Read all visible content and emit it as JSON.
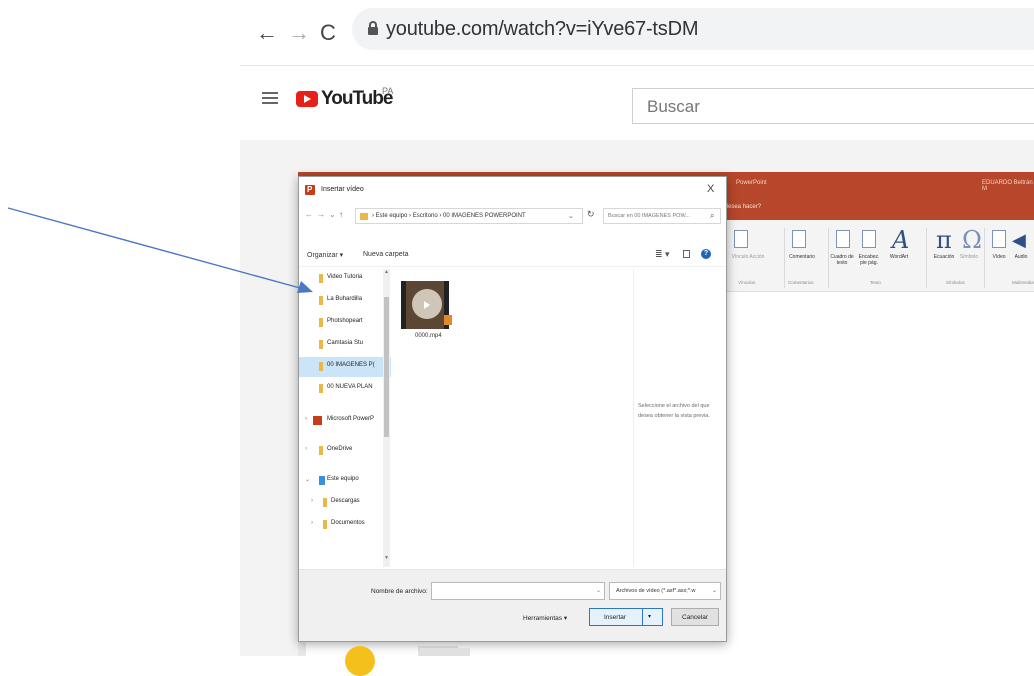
{
  "browser": {
    "back": "←",
    "forward": "→",
    "reload": "C",
    "url": "youtube.com/watch?v=iYve67-tsDM"
  },
  "youtube": {
    "logo_word": "YouTube",
    "country": "PA",
    "search_placeholder": "Buscar"
  },
  "powerpoint": {
    "title": "PowerPoint",
    "user": "EDUARDO Beltrán M",
    "tell_me": "¿Qué desea hacer?",
    "ribbon": [
      {
        "label": "Comentario",
        "group": "Comentarios"
      },
      {
        "label": "Cuadro de texto",
        "group": "Texto"
      },
      {
        "label": "Encabez. pie pág.",
        "group": ""
      },
      {
        "label": "WordArt",
        "group": ""
      },
      {
        "label": "Ecuación",
        "group": "Símbolos"
      },
      {
        "label": "Símbolo",
        "group": ""
      },
      {
        "label": "Vídeo",
        "group": "Multimedia"
      },
      {
        "label": "Audio",
        "group": ""
      }
    ],
    "group_vinculos": "Vínculos",
    "dim_label": "Vínculo Acción"
  },
  "dialog": {
    "title": "Insertar vídeo",
    "close": "X",
    "address": "› Este equipo › Escritorio › 00 IMAGENES POWERPOINT",
    "search_placeholder": "Buscar en 00 IMAGENES POW...",
    "organize": "Organizar ▾",
    "new_folder": "Nueva carpeta",
    "help": "?",
    "nav_items": [
      {
        "label": "Video Tutoria"
      },
      {
        "label": "La Buhardilla"
      },
      {
        "label": "Photshopeart"
      },
      {
        "label": "Camtasia Stu"
      },
      {
        "label": "00 IMAGENES P("
      },
      {
        "label": "00 NUEVA PLAN"
      },
      {
        "label": "Microsoft PowerP"
      },
      {
        "label": "OneDrive"
      },
      {
        "label": "Este equipo"
      },
      {
        "label": "Descargas"
      },
      {
        "label": "Documentos"
      }
    ],
    "file": {
      "name": "0000.mp4"
    },
    "preview_text": "Seleccione el archivo del que desea obtener la vista previa.",
    "filename_label": "Nombre de archivo:",
    "filename_value": "",
    "filetype": "Archivos de vídeo (*.asf*.asx;*.w",
    "tools": "Herramientas ▾",
    "insert": "Insertar",
    "cancel": "Cancelar"
  },
  "colors": {
    "ppt_accent": "#b7472a",
    "youtube_red": "#e62117",
    "arrow": "#4a78c2"
  }
}
